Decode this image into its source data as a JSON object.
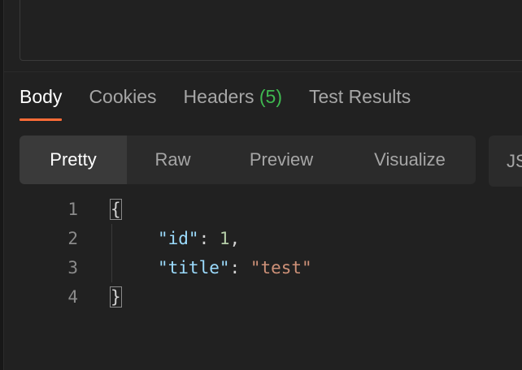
{
  "response": {
    "tabs": [
      {
        "label": "Body",
        "active": true
      },
      {
        "label": "Cookies",
        "active": false
      },
      {
        "label": "Headers",
        "count": "(5)",
        "active": false
      },
      {
        "label": "Test Results",
        "active": false
      }
    ],
    "view_modes": [
      {
        "label": "Pretty",
        "active": true
      },
      {
        "label": "Raw",
        "active": false
      },
      {
        "label": "Preview",
        "active": false
      },
      {
        "label": "Visualize",
        "active": false
      }
    ],
    "language_select": "JSON"
  },
  "code": {
    "line_numbers": [
      "1",
      "2",
      "3",
      "4"
    ],
    "open_brace": "{",
    "close_brace": "}",
    "fields": [
      {
        "key": "\"id\"",
        "colon": ": ",
        "value": "1",
        "trail": ","
      },
      {
        "key": "\"title\"",
        "colon": ": ",
        "value": "\"test\"",
        "trail": ""
      }
    ]
  },
  "colors": {
    "background": "#212121",
    "accent_underline": "#ff6c37",
    "header_count": "#3fb950",
    "json_key": "#9cdcfe",
    "json_number": "#b5cea8",
    "json_string": "#ce9178"
  }
}
